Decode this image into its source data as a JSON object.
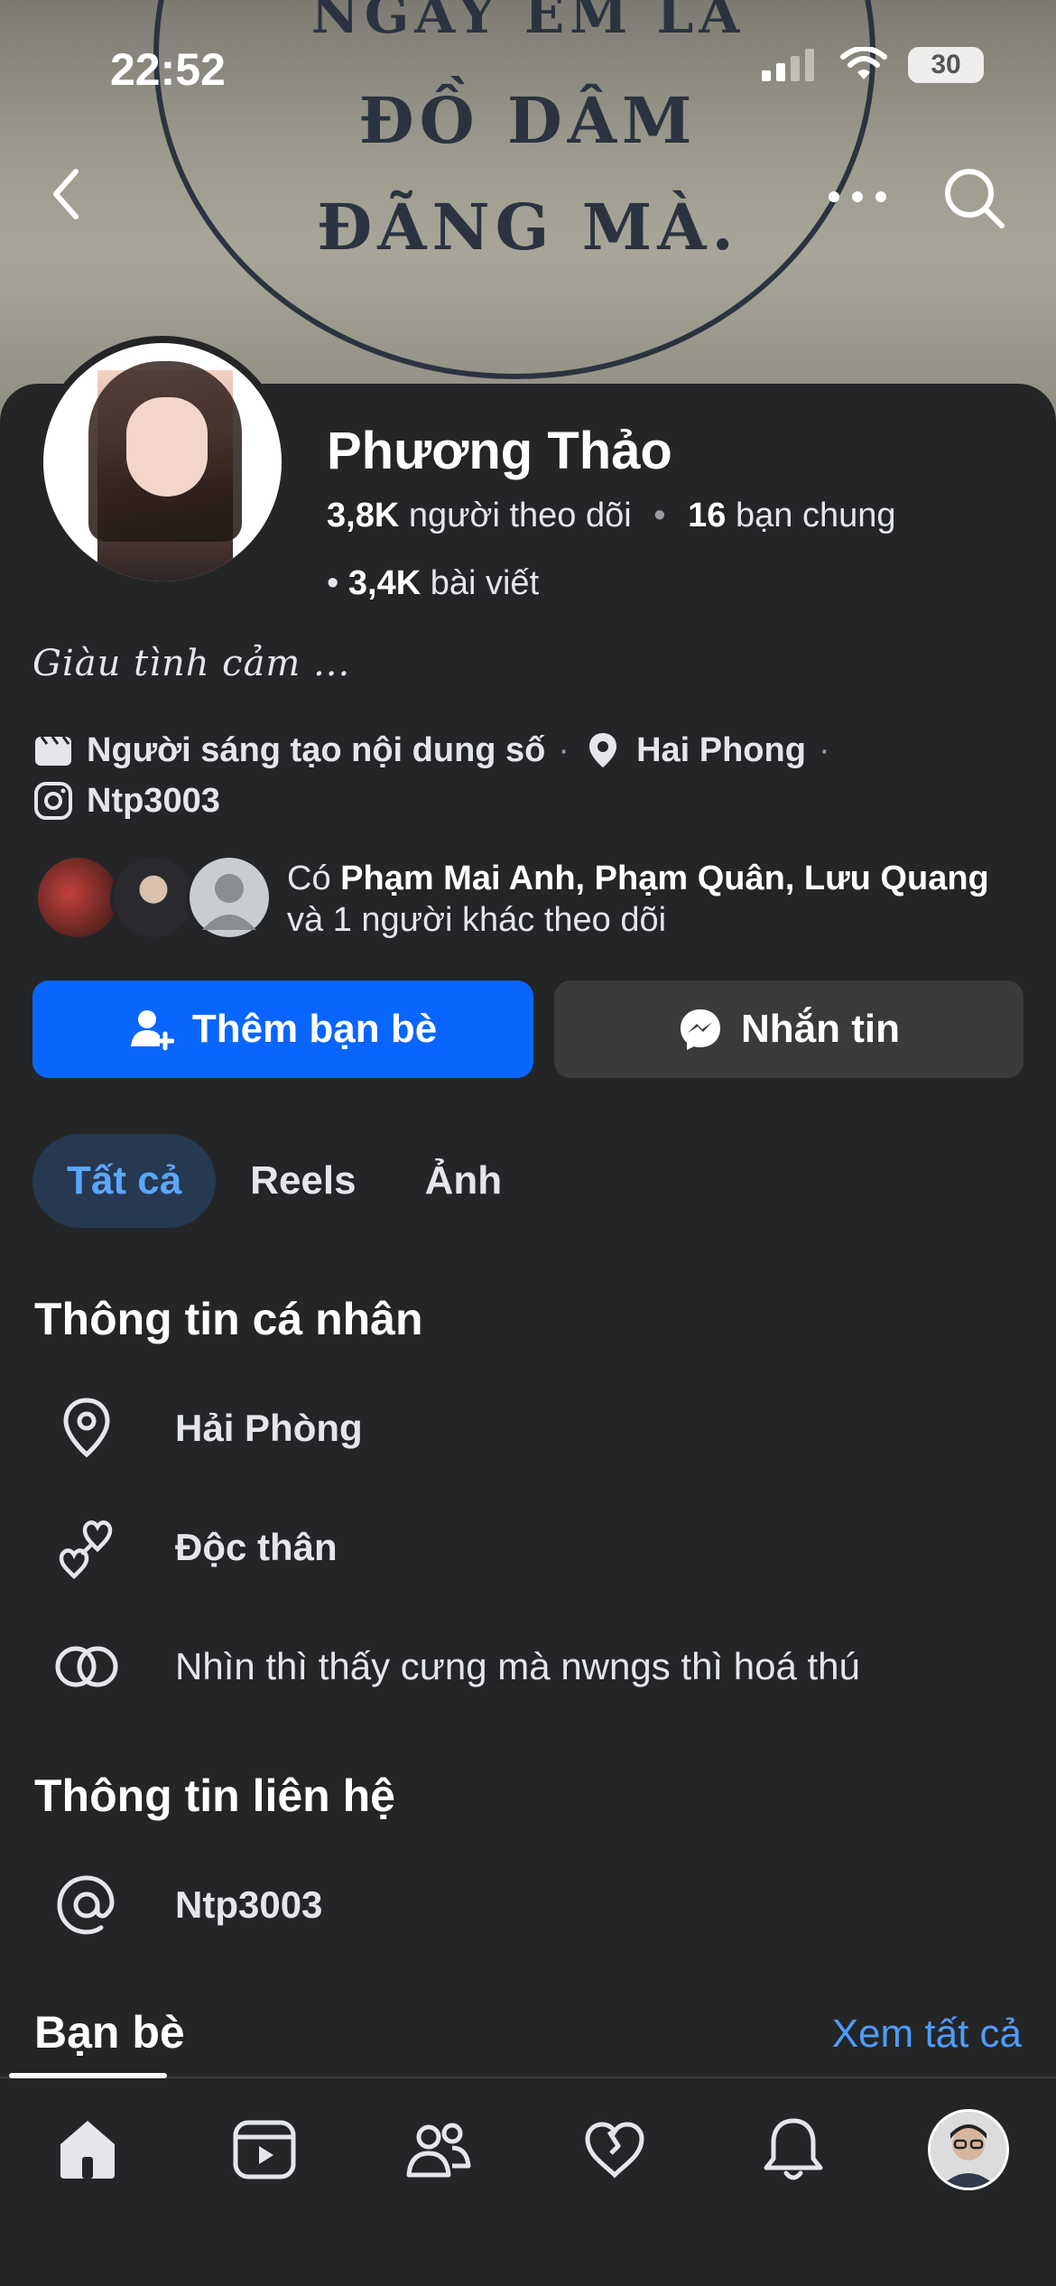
{
  "status_bar": {
    "time": "22:52",
    "battery": "30"
  },
  "cover": {
    "lines": [
      "NGAY EM LÀ",
      "ĐỒ DÂM",
      "ĐÃNG MÀ."
    ]
  },
  "profile": {
    "name": "Phương Thảo",
    "followers_count": "3,8K",
    "followers_label": "người theo dõi",
    "mutual_count": "16",
    "mutual_label": "bạn chung",
    "posts_count": "3,4K",
    "posts_label": "bài viết",
    "bio": "Giàu tình cảm  ..."
  },
  "info": {
    "category": "Người sáng tạo nội dung số",
    "location": "Hai Phong",
    "instagram": "Ntp3003"
  },
  "mutuals": {
    "prefix": "Có",
    "names": "Phạm Mai Anh, Phạm Quân, Lưu Quang",
    "suffix": "và 1 người khác theo dõi"
  },
  "actions": {
    "add_friend": "Thêm bạn bè",
    "message": "Nhắn tin"
  },
  "tabs": [
    {
      "label": "Tất cả",
      "active": true
    },
    {
      "label": "Reels"
    },
    {
      "label": "Ảnh"
    }
  ],
  "personal_info": {
    "title": "Thông tin cá nhân",
    "hometown": "Hải Phòng",
    "relationship": "Độc thân",
    "interest": "Nhìn thì thấy cưng mà nwngs thì hoá thú"
  },
  "contact_info": {
    "title": "Thông tin liên hệ",
    "handle": "Ntp3003"
  },
  "friends": {
    "title": "Bạn bè",
    "see_all": "Xem tất cả"
  },
  "colors": {
    "accent": "#0866ff",
    "link": "#4e9bff",
    "background": "#242526"
  }
}
